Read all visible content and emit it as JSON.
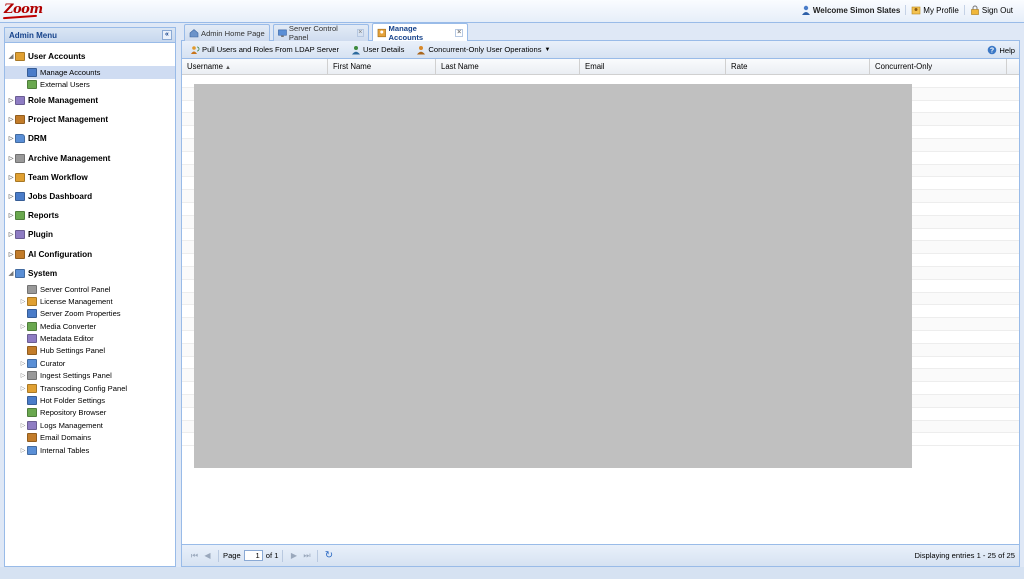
{
  "app": {
    "logo": "Zoom",
    "welcome": "Welcome Simon Slates",
    "my_profile": "My Profile",
    "sign_out": "Sign Out"
  },
  "sidebar": {
    "title": "Admin Menu",
    "collapse_glyph": "«",
    "nodes": [
      {
        "label": "User Accounts",
        "level": 0,
        "top": true,
        "expanded": true,
        "icon": "users-icon"
      },
      {
        "label": "Manage Accounts",
        "level": 1,
        "selected": true,
        "icon": "manage-accounts-icon"
      },
      {
        "label": "External Users",
        "level": 1,
        "icon": "external-users-icon"
      },
      {
        "label": "Role Management",
        "level": 0,
        "top": true,
        "icon": "role-shield-icon"
      },
      {
        "label": "Project Management",
        "level": 0,
        "top": true,
        "icon": "project-globe-icon"
      },
      {
        "label": "DRM",
        "level": 0,
        "top": true,
        "icon": "folder-icon"
      },
      {
        "label": "Archive Management",
        "level": 0,
        "top": true,
        "icon": "archive-icon"
      },
      {
        "label": "Team Workflow",
        "level": 0,
        "top": true,
        "icon": "workflow-icon"
      },
      {
        "label": "Jobs Dashboard",
        "level": 0,
        "top": true,
        "icon": "dashboard-icon"
      },
      {
        "label": "Reports",
        "level": 0,
        "top": true,
        "icon": "reports-icon"
      },
      {
        "label": "Plugin",
        "level": 0,
        "top": true,
        "icon": "plugin-icon"
      },
      {
        "label": "AI Configuration",
        "level": 0,
        "top": true,
        "icon": "ai-config-icon"
      },
      {
        "label": "System",
        "level": 0,
        "top": true,
        "expanded": true,
        "icon": "system-icon"
      },
      {
        "label": "Server Control Panel",
        "level": 1,
        "icon": "monitor-icon"
      },
      {
        "label": "License Management",
        "level": 1,
        "expandable": true,
        "icon": "license-icon"
      },
      {
        "label": "Server Zoom Properties",
        "level": 1,
        "icon": "properties-icon"
      },
      {
        "label": "Media Converter",
        "level": 1,
        "expandable": true,
        "icon": "converter-icon"
      },
      {
        "label": "Metadata Editor",
        "level": 1,
        "icon": "metadata-icon"
      },
      {
        "label": "Hub Settings Panel",
        "level": 1,
        "icon": "monitor-icon"
      },
      {
        "label": "Curator",
        "level": 1,
        "expandable": true,
        "icon": "hierarchy-icon"
      },
      {
        "label": "Ingest Settings Panel",
        "level": 1,
        "expandable": true,
        "icon": "hierarchy-icon"
      },
      {
        "label": "Transcoding Config Panel",
        "level": 1,
        "expandable": true,
        "icon": "hierarchy-icon"
      },
      {
        "label": "Hot Folder Settings",
        "level": 1,
        "icon": "hot-folder-icon"
      },
      {
        "label": "Repository Browser",
        "level": 1,
        "icon": "hierarchy-icon"
      },
      {
        "label": "Logs Management",
        "level": 1,
        "expandable": true,
        "icon": "logs-icon"
      },
      {
        "label": "Email Domains",
        "level": 1,
        "icon": "email-domains-icon"
      },
      {
        "label": "Internal Tables",
        "level": 1,
        "expandable": true,
        "icon": "table-icon"
      }
    ]
  },
  "tabs": [
    {
      "label": "Admin Home Page",
      "closable": false,
      "active": false,
      "icon": "home-icon"
    },
    {
      "label": "Server Control Panel",
      "closable": true,
      "active": false,
      "icon": "monitor-icon"
    },
    {
      "label": "Manage Accounts",
      "closable": true,
      "active": true,
      "icon": "manage-accounts-icon"
    }
  ],
  "toolbar": {
    "pull_users": "Pull Users and Roles From LDAP Server",
    "user_details": "User Details",
    "concurrent_ops": "Concurrent-Only User Operations",
    "help": "Help"
  },
  "grid": {
    "columns": [
      {
        "label": "Username",
        "sorted": "asc"
      },
      {
        "label": "First Name"
      },
      {
        "label": "Last Name"
      },
      {
        "label": "Email"
      },
      {
        "label": "Rate"
      },
      {
        "label": "Concurrent-Only"
      }
    ],
    "row_count": 25
  },
  "pager": {
    "page_label": "Page",
    "page_value": "1",
    "of_label": "of 1",
    "display_msg": "Displaying entries 1 - 25 of 25"
  },
  "colors": {
    "accent": "#15428b",
    "border": "#99bbe8",
    "selected_row": "#cfdcf2",
    "redaction": "#c0c0c0"
  }
}
